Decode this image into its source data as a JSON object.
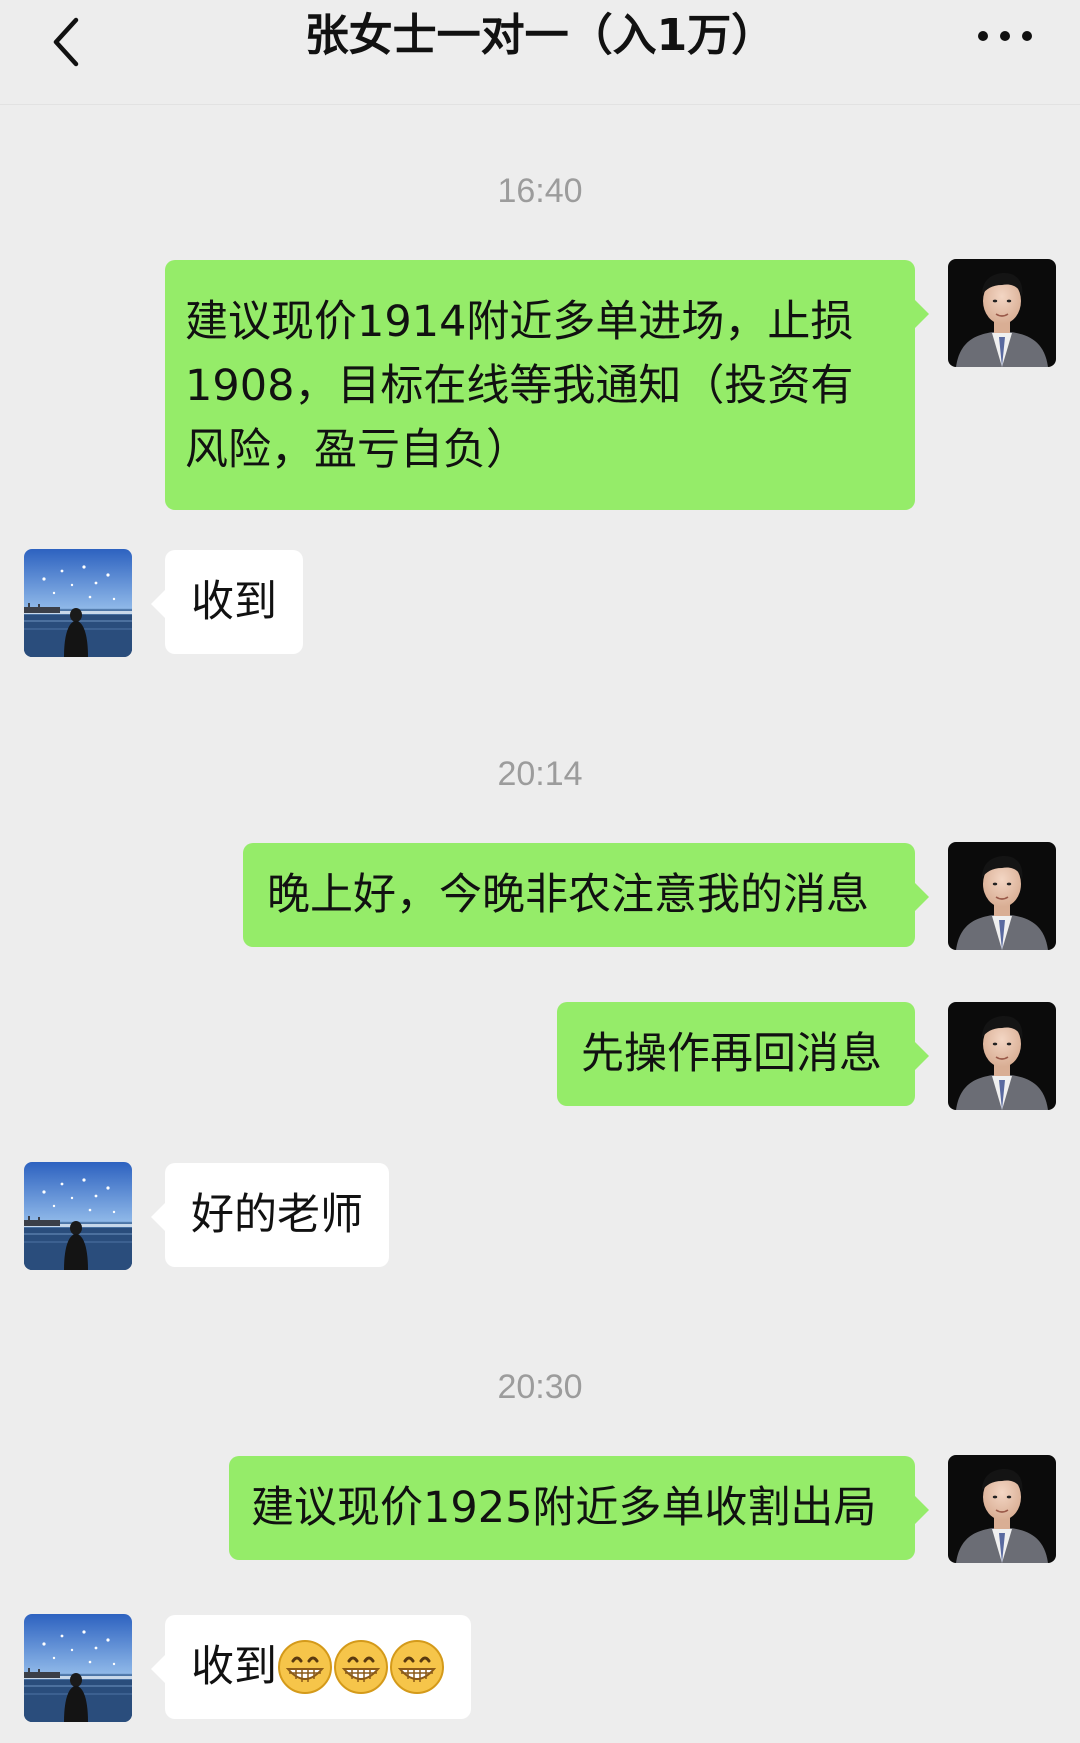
{
  "header": {
    "title": "张女士一对一（入1万）",
    "back_icon": "chevron-left-icon",
    "more_icon": "more-dots-icon"
  },
  "messages": {
    "ts1": "16:40",
    "m1": "建议现价1914附近多单进场，止损1908，目标在线等我通知（投资有风险，盈亏自负）",
    "m2": "收到",
    "ts2": "20:14",
    "m3": "晚上好，今晚非农注意我的消息",
    "m4": "先操作再回消息",
    "m5": "好的老师",
    "ts3": "20:30",
    "m6": "建议现价1925附近多单收割出局",
    "m7": "收到"
  },
  "colors": {
    "background": "#ededed",
    "outgoing_bubble": "#95ec69",
    "incoming_bubble": "#ffffff",
    "timestamp": "#9c9c9c"
  },
  "icons": {
    "m7_suffix": "grinning-face-emoji x3"
  }
}
